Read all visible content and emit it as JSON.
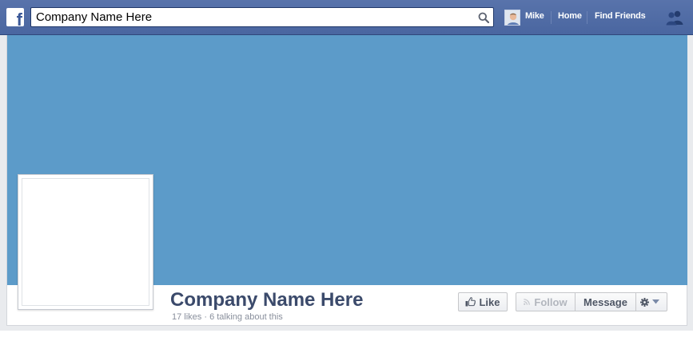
{
  "topbar": {
    "search": {
      "value": "Company Name Here",
      "placeholder": ""
    },
    "user_name": "Mike",
    "home_label": "Home",
    "find_friends_label": "Find Friends"
  },
  "page": {
    "name": "Company Name Here",
    "stats": "17 likes · 6 talking about this"
  },
  "actions": {
    "like_label": "Like",
    "follow_label": "Follow",
    "message_label": "Message"
  },
  "colors": {
    "topbar": "#4a66a0",
    "cover": "#5c9bc9",
    "page_name": "#3b4a6b",
    "stats": "#898f9c",
    "disabled_text": "#b2b6be"
  },
  "icons": {
    "logo": "facebook-logo",
    "search": "search-icon",
    "friends": "friend-requests-icon",
    "like": "thumbs-up-icon",
    "follow": "rss-icon",
    "settings": "gear-icon",
    "dropdown": "caret-down-icon"
  }
}
